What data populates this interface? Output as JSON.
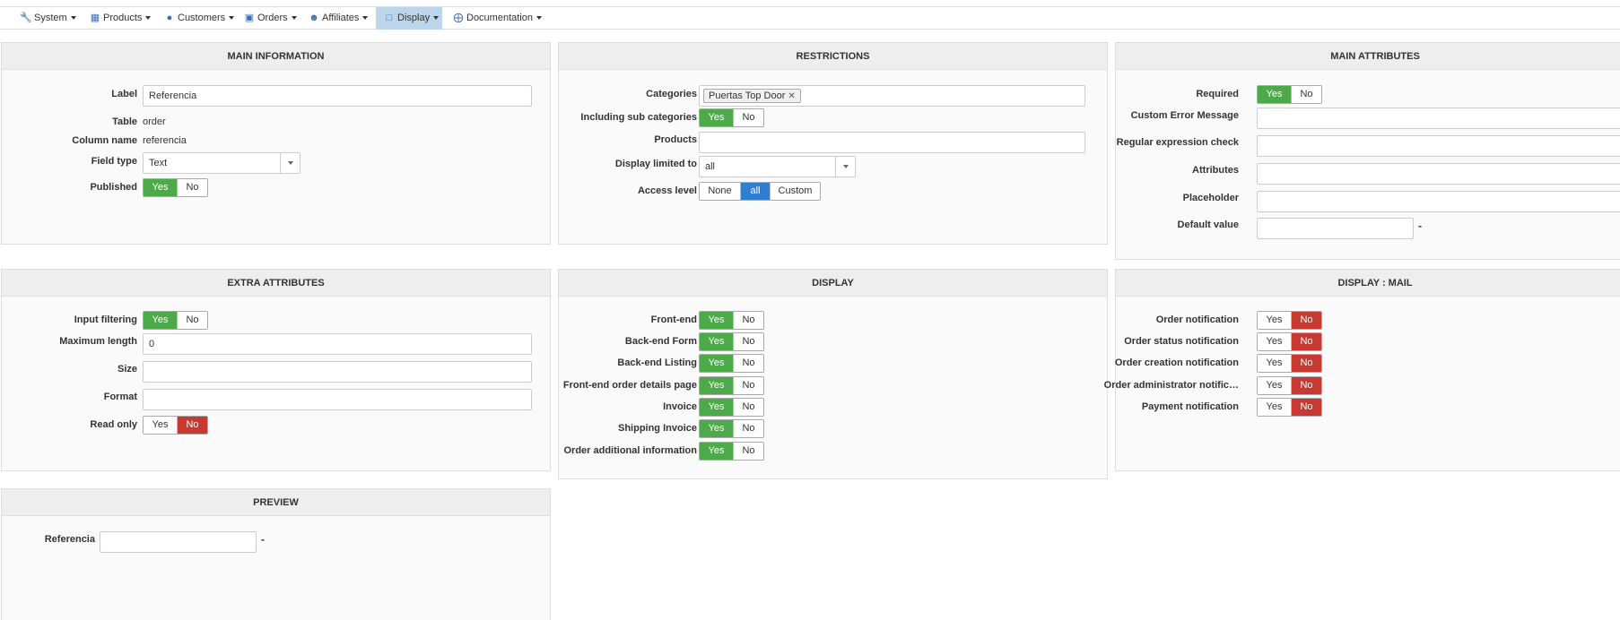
{
  "nav": {
    "items": [
      {
        "label": "System",
        "icon": "wrench-icon"
      },
      {
        "label": "Products",
        "icon": "cubes-icon"
      },
      {
        "label": "Customers",
        "icon": "user-icon"
      },
      {
        "label": "Orders",
        "icon": "credit-card-icon"
      },
      {
        "label": "Affiliates",
        "icon": "users-icon"
      },
      {
        "label": "Display",
        "icon": "monitor-icon"
      },
      {
        "label": "Documentation",
        "icon": "lifebuoy-icon"
      }
    ],
    "active": "Display"
  },
  "main_information": {
    "title": "MAIN INFORMATION",
    "label_label": "Label",
    "label_value": "Referencia",
    "table_label": "Table",
    "table_value": "order",
    "column_label": "Column name",
    "column_value": "referencia",
    "field_type_label": "Field type",
    "field_type_value": "Text",
    "published_label": "Published",
    "yes": "Yes",
    "no": "No"
  },
  "restrictions": {
    "title": "RESTRICTIONS",
    "categories_label": "Categories",
    "category_tag": "Puertas Top Door",
    "tag_remove": "✕",
    "sub_label": "Including sub categories",
    "yes": "Yes",
    "no": "No",
    "products_label": "Products",
    "display_limited_label": "Display limited to",
    "display_limited_value": "all",
    "access_label": "Access level",
    "access_none": "None",
    "access_all": "all",
    "access_custom": "Custom"
  },
  "main_attributes": {
    "title": "MAIN ATTRIBUTES",
    "required_label": "Required",
    "yes": "Yes",
    "no": "No",
    "custom_error_label": "Custom Error Message",
    "regex_label": "Regular expression check",
    "attributes_label": "Attributes",
    "placeholder_label": "Placeholder",
    "default_label": "Default value",
    "dash": "-"
  },
  "extra_attributes": {
    "title": "EXTRA ATTRIBUTES",
    "input_filtering_label": "Input filtering",
    "max_length_label": "Maximum length",
    "max_length_value": "0",
    "size_label": "Size",
    "format_label": "Format",
    "read_only_label": "Read only",
    "yes": "Yes",
    "no": "No"
  },
  "display": {
    "title": "DISPLAY",
    "rows": [
      "Front-end",
      "Back-end Form",
      "Back-end Listing",
      "Front-end order details page",
      "Invoice",
      "Shipping Invoice",
      "Order additional information"
    ],
    "yes": "Yes",
    "no": "No"
  },
  "display_mail": {
    "title": "DISPLAY : MAIL",
    "rows": [
      "Order notification",
      "Order status notification",
      "Order creation notification",
      "Order administrator notific…",
      "Payment notification"
    ],
    "yes": "Yes",
    "no": "No"
  },
  "preview": {
    "title": "PREVIEW",
    "field_label": "Referencia",
    "dash": "-"
  },
  "colors": {
    "yes_active": "#4caa48",
    "no_active": "#c83a31",
    "selected": "#2f7fd0",
    "nav_active": "#bcd5ea"
  }
}
